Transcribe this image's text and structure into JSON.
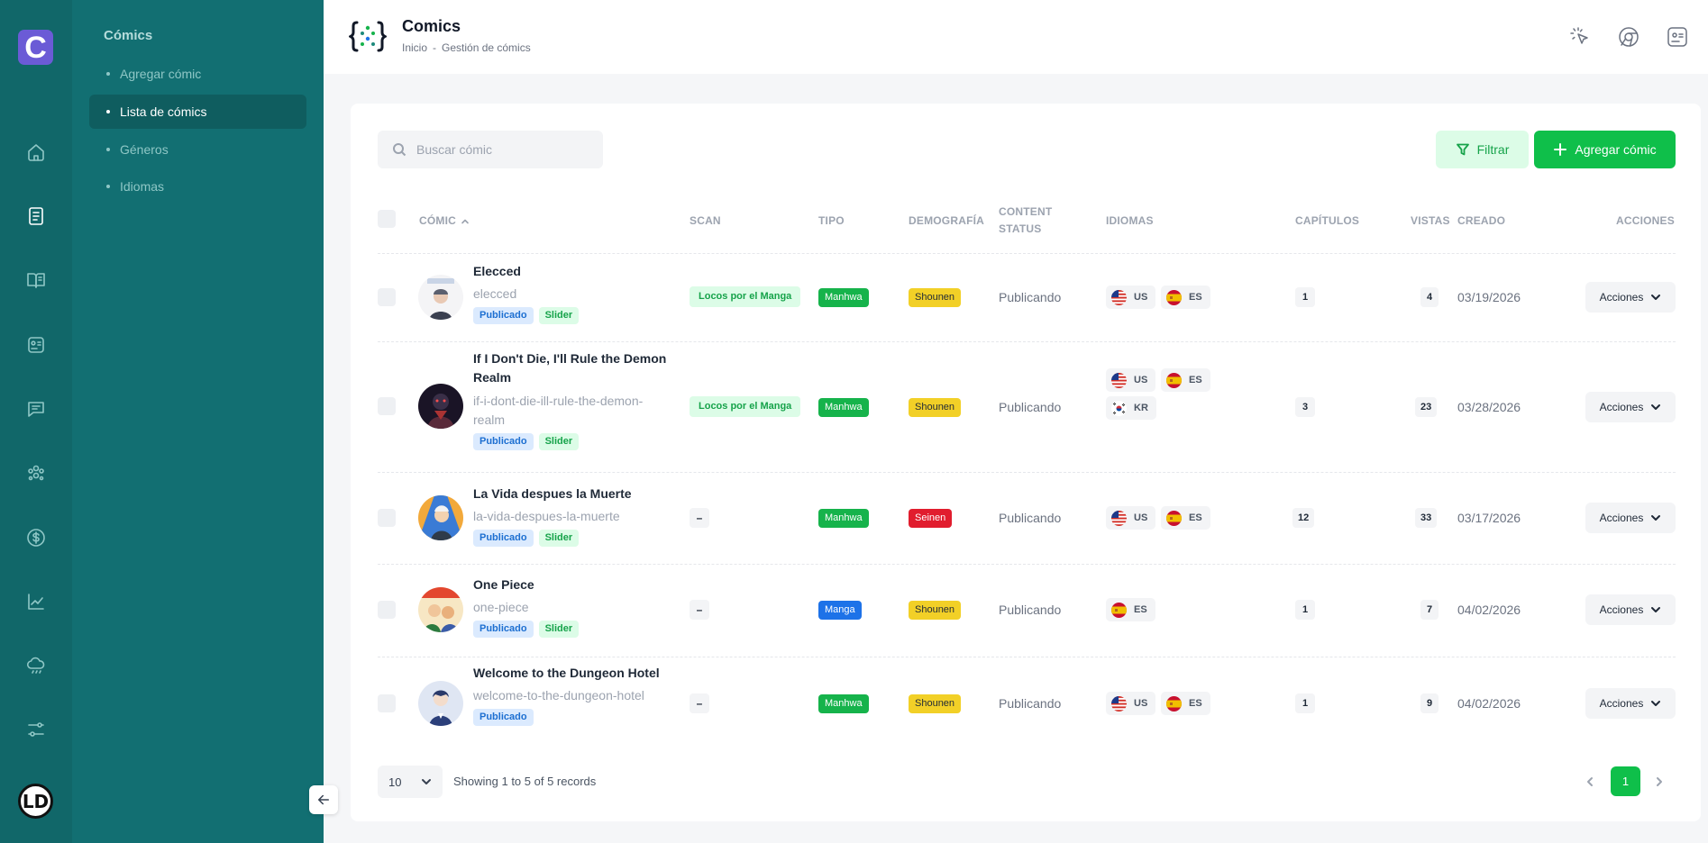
{
  "app": {
    "logo_letter": "C",
    "user_initials": "LD"
  },
  "rail": {
    "items": [
      {
        "icon": "home-icon"
      },
      {
        "icon": "document-list-icon",
        "active": true
      },
      {
        "icon": "book-open-icon"
      },
      {
        "icon": "profile-card-icon"
      },
      {
        "icon": "chat-icon"
      },
      {
        "icon": "users-group-icon"
      },
      {
        "icon": "dollar-icon"
      },
      {
        "icon": "chart-line-icon"
      },
      {
        "icon": "cloud-icon"
      },
      {
        "icon": "sliders-icon"
      }
    ]
  },
  "subnav": {
    "title": "Cómics",
    "items": [
      {
        "label": "Agregar cómic"
      },
      {
        "label": "Lista de cómics",
        "active": true
      },
      {
        "label": "Géneros"
      },
      {
        "label": "Idiomas"
      }
    ]
  },
  "header": {
    "title": "Comics",
    "breadcrumb": [
      "Inicio",
      "Gestión de cómics"
    ],
    "breadcrumb_sep": "-"
  },
  "toolbar": {
    "search_placeholder": "Buscar cómic",
    "filter_label": "Filtrar",
    "add_label": "Agregar cómic"
  },
  "table": {
    "columns": {
      "comic": "Cómic",
      "scan": "Scan",
      "tipo": "Tipo",
      "demografia": "Demografía",
      "content_status": "Content Status",
      "idiomas": "Idiomas",
      "capitulos": "Capítulos",
      "vistas": "Vistas",
      "creado": "Creado",
      "acciones": "Acciones"
    },
    "actions_label": "Acciones",
    "rows": [
      {
        "name": "Elecced",
        "slug": "elecced",
        "tags": [
          "Publicado",
          "Slider"
        ],
        "scan": "Locos por el Manga",
        "tipo": "Manhwa",
        "demografia": "Shounen",
        "status": "Publicando",
        "idiomas": [
          "US",
          "ES"
        ],
        "capitulos": "1",
        "vistas": "4",
        "creado": "03/19/2026"
      },
      {
        "name": "If I Don't Die, I'll Rule the Demon Realm",
        "slug": "if-i-dont-die-ill-rule-the-demon-realm",
        "tags": [
          "Publicado",
          "Slider"
        ],
        "scan": "Locos por el Manga",
        "tipo": "Manhwa",
        "demografia": "Shounen",
        "status": "Publicando",
        "idiomas": [
          "US",
          "ES",
          "KR"
        ],
        "capitulos": "3",
        "vistas": "23",
        "creado": "03/28/2026"
      },
      {
        "name": "La Vida despues la Muerte",
        "slug": "la-vida-despues-la-muerte",
        "tags": [
          "Publicado",
          "Slider"
        ],
        "scan": "–",
        "tipo": "Manhwa",
        "demografia": "Seinen",
        "status": "Publicando",
        "idiomas": [
          "US",
          "ES"
        ],
        "capitulos": "12",
        "vistas": "33",
        "creado": "03/17/2026"
      },
      {
        "name": "One Piece",
        "slug": "one-piece",
        "tags": [
          "Publicado",
          "Slider"
        ],
        "scan": "–",
        "tipo": "Manga",
        "demografia": "Shounen",
        "status": "Publicando",
        "idiomas": [
          "ES"
        ],
        "capitulos": "1",
        "vistas": "7",
        "creado": "04/02/2026"
      },
      {
        "name": "Welcome to the Dungeon Hotel",
        "slug": "welcome-to-the-dungeon-hotel",
        "tags": [
          "Publicado"
        ],
        "scan": "–",
        "tipo": "Manhwa",
        "demografia": "Shounen",
        "status": "Publicando",
        "idiomas": [
          "US",
          "ES"
        ],
        "capitulos": "1",
        "vistas": "9",
        "creado": "04/02/2026"
      }
    ]
  },
  "footer": {
    "page_size": "10",
    "info": "Showing 1 to 5 of 5 records",
    "current_page": "1"
  },
  "colors": {
    "rail": "#116769",
    "subnav": "#126f72",
    "primary_green": "#0fbf4a",
    "manhwa": "#16b34b",
    "manga": "#1d72e8",
    "shounen": "#f2d027",
    "seinen": "#e11d2e"
  }
}
